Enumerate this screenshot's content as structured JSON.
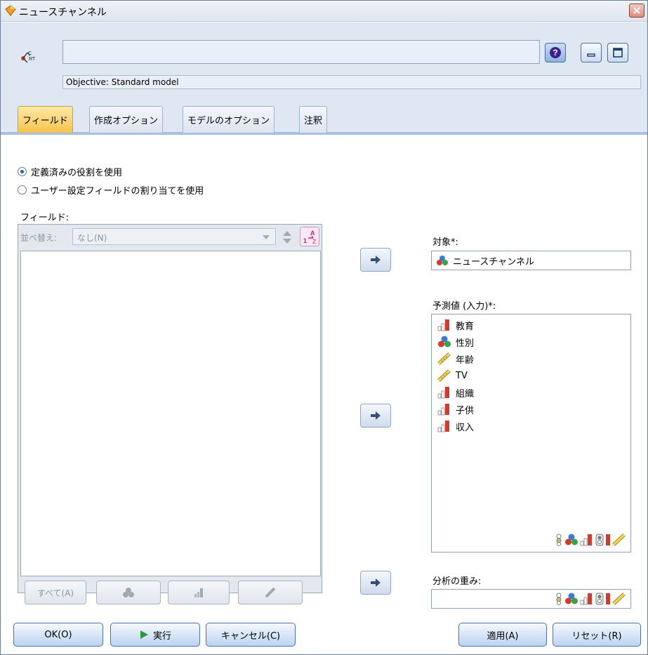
{
  "window": {
    "title": "ニュースチャンネル"
  },
  "header": {
    "objective": "Objective: Standard model"
  },
  "tabs": [
    {
      "label": "フィールド",
      "active": true
    },
    {
      "label": "作成オプション",
      "active": false
    },
    {
      "label": "モデルのオプション",
      "active": false
    },
    {
      "label": "注釈",
      "active": false
    }
  ],
  "options": {
    "radio_predefined": "定義済みの役割を使用",
    "radio_custom": "ユーザー設定フィールドの割り当てを使用",
    "selected": "predefined"
  },
  "fields": {
    "label": "フィールド:",
    "sort_label": "並べ替え:",
    "sort_value": "なし(N)",
    "btn_all": "すべて(A)"
  },
  "target": {
    "label": "対象*:",
    "value": "ニュースチャンネル"
  },
  "predictors": {
    "label": "予測値 (入力)*:",
    "items": [
      {
        "name": "教育",
        "icon": "ordinal-icon"
      },
      {
        "name": "性別",
        "icon": "nominal-icon"
      },
      {
        "name": "年齢",
        "icon": "continuous-icon"
      },
      {
        "name": "TV",
        "icon": "continuous-icon"
      },
      {
        "name": "組織",
        "icon": "ordinal-icon"
      },
      {
        "name": "子供",
        "icon": "ordinal-icon"
      },
      {
        "name": "収入",
        "icon": "ordinal-icon"
      }
    ]
  },
  "weight": {
    "label": "分析の重み:"
  },
  "footer": {
    "ok": "OK(O)",
    "run": "実行",
    "cancel": "キャンセル(C)",
    "apply": "適用(A)",
    "reset": "リセット(R)"
  },
  "colors": {
    "active_tab": "#f7c34a",
    "header_bg": "#dfe7f2",
    "accent_blue": "#2a5db0",
    "ordinal_red": "#d23a2a"
  }
}
